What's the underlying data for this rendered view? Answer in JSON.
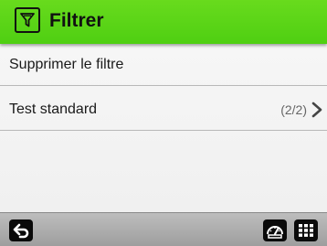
{
  "header": {
    "title": "Filtrer",
    "icon": "filter-icon",
    "background": "#5bd718"
  },
  "list": {
    "items": [
      {
        "label": "Supprimer le filtre"
      },
      {
        "label": "Test standard",
        "count": "(2/2)",
        "icon": "chevron-right-icon"
      }
    ]
  },
  "bottom_bar": {
    "back": "back-icon",
    "gauge": "gauge-icon",
    "apps": "grid-icon"
  }
}
